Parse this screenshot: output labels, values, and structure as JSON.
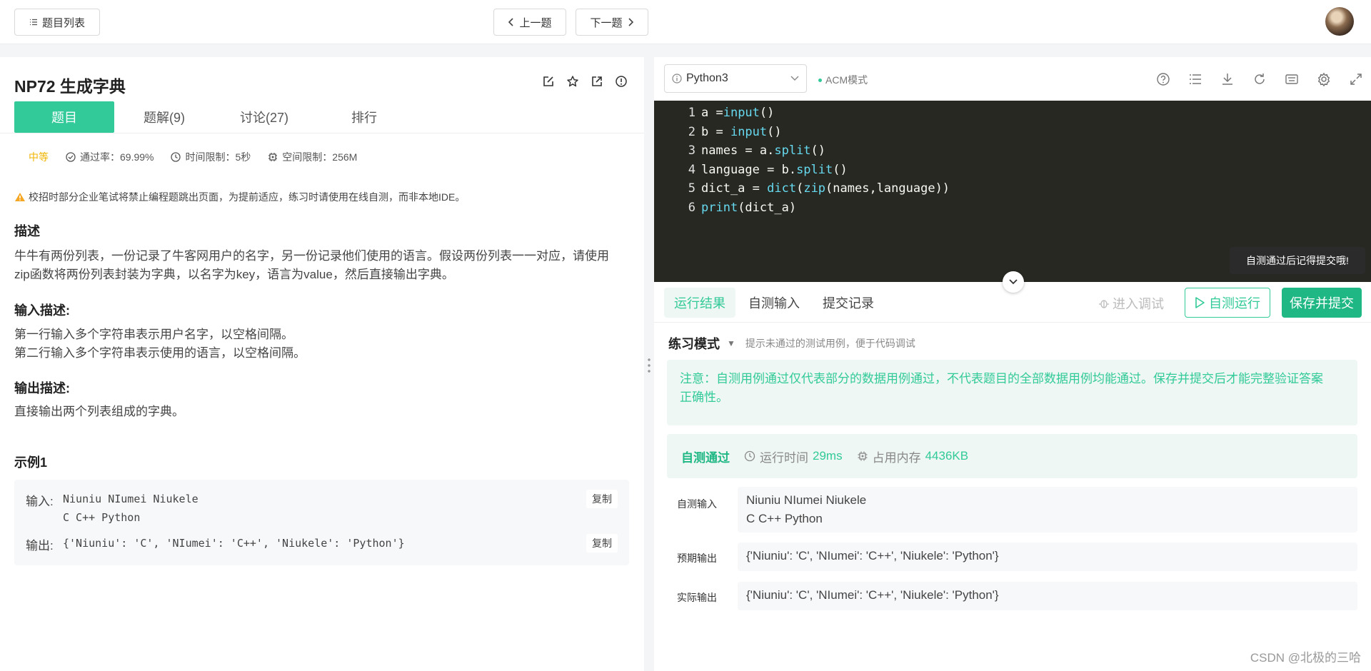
{
  "topbar": {
    "list_label": "题目列表",
    "prev_label": "上一题",
    "next_label": "下一题"
  },
  "problem": {
    "title": "NP72  生成字典",
    "tabs": [
      {
        "label": "题目"
      },
      {
        "label": "题解(9)"
      },
      {
        "label": "讨论(27)"
      },
      {
        "label": "排行"
      }
    ],
    "difficulty": "中等",
    "pass_rate": "通过率：69.99%",
    "time_limit": "时间限制：5秒",
    "memory_limit": "空间限制：256M",
    "notice": "校招时部分企业笔试将禁止编程题跳出页面，为提前适应，练习时请使用在线自测，而非本地IDE。",
    "desc_heading": "描述",
    "desc_line1": "牛牛有两份列表，一份记录了牛客网用户的名字，另一份记录他们使用的语言。假设两份列表一一对应，请使用",
    "desc_line2": "zip函数将两份列表封装为字典，以名字为key，语言为value，然后直接输出字典。",
    "input_heading": "输入描述:",
    "input_line1": "第一行输入多个字符串表示用户名字，以空格间隔。",
    "input_line2": "第二行输入多个字符串表示使用的语言，以空格间隔。",
    "output_heading": "输出描述:",
    "output_line1": "直接输出两个列表组成的字典。",
    "example_heading": "示例1",
    "example_input_label": "输入:",
    "example_input_line1": "Niuniu NIumei Niukele",
    "example_input_line2": "C C++ Python",
    "example_output_label": "输出:",
    "example_output": "{'Niuniu': 'C', 'NIumei': 'C++', 'Niukele': 'Python'}",
    "copy_label": "复制"
  },
  "editor": {
    "language": "Python3",
    "mode": "ACM模式",
    "tooltip": "自测通过后记得提交哦!"
  },
  "results": {
    "tabs": [
      {
        "label": "运行结果"
      },
      {
        "label": "自测输入"
      },
      {
        "label": "提交记录"
      }
    ],
    "debug_label": "进入调试",
    "run_label": "自测运行",
    "submit_label": "保存并提交",
    "practice_mode": "练习模式",
    "practice_hint": "提示未通过的测试用例，便于代码调试",
    "note_line1": "注意：自测用例通过仅代表部分的数据用例通过，不代表题目的全部数据用例均能通过。保存并提交后才能完整验证答案",
    "note_line2": "正确性。",
    "status": "自测通过",
    "runtime_label": "运行时间",
    "runtime_value": "29ms",
    "memory_label": "占用内存",
    "memory_value": "4436KB",
    "self_input_label": "自测输入",
    "self_input_line1": "Niuniu NIumei Niukele",
    "self_input_line2": "C C++ Python",
    "expected_label": "预期输出",
    "expected_value": "{'Niuniu': 'C', 'NIumei': 'C++', 'Niukele': 'Python'}",
    "actual_label": "实际输出",
    "actual_value": "{'Niuniu': 'C', 'NIumei': 'C++', 'Niukele': 'Python'}"
  },
  "watermark": "CSDN @北极的三哈",
  "colors": {
    "accent": "#32ca99",
    "submit": "#1fb784",
    "editor_bg": "#272822",
    "difficulty": "#f0b400"
  },
  "icons": [
    "list-icon",
    "chevron-left-icon",
    "chevron-right-icon",
    "edit-icon",
    "star-icon",
    "share-icon",
    "info-icon",
    "check-circle-icon",
    "clock-icon",
    "chip-icon",
    "warning-icon",
    "help-icon",
    "list-lines-icon",
    "download-icon",
    "refresh-icon",
    "keyboard-icon",
    "gear-icon",
    "expand-icon",
    "chevron-down-icon",
    "play-icon",
    "bug-icon"
  ]
}
